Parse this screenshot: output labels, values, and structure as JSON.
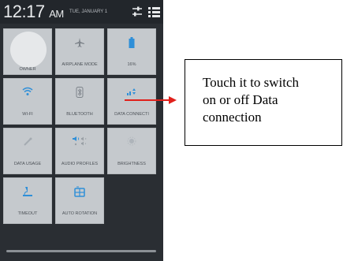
{
  "statusbar": {
    "time": "12:17",
    "ampm": "AM",
    "date": "TUE, JANUARY 1",
    "icons": [
      "settings-sliders-icon",
      "list-menu-icon"
    ]
  },
  "tiles": {
    "owner": {
      "label": "OWNER",
      "icon": "avatar"
    },
    "airplane": {
      "label": "AIRPLANE MODE",
      "icon": "airplane-icon"
    },
    "battery": {
      "label": "16%",
      "icon": "battery-icon"
    },
    "wifi": {
      "label": "WI-FI",
      "icon": "wifi-icon"
    },
    "bluetooth": {
      "label": "BLUETOOTH",
      "icon": "bluetooth-icon"
    },
    "data": {
      "label": "DATA CONNECTI",
      "icon": "data-connection-icon"
    },
    "data_usage": {
      "label": "DATA USAGE",
      "icon": "data-usage-icon"
    },
    "audio": {
      "label": "AUDIO PROFILES",
      "icon": "audio-profiles-icon"
    },
    "brightness": {
      "label": "BRIGHTNESS",
      "icon": "brightness-icon"
    },
    "timeout": {
      "label": "TIMEOUT",
      "icon": "timeout-icon"
    },
    "rotation": {
      "label": "AUTO ROTATION",
      "icon": "auto-rotation-icon"
    }
  },
  "colors": {
    "accent": "#1a8fe0",
    "arrow": "#e0201b",
    "tile": "#c5c9cd",
    "panel": "#2a2e33"
  },
  "callout": {
    "lines": [
      "Touch it to switch",
      "on or off Data",
      "connection"
    ]
  }
}
